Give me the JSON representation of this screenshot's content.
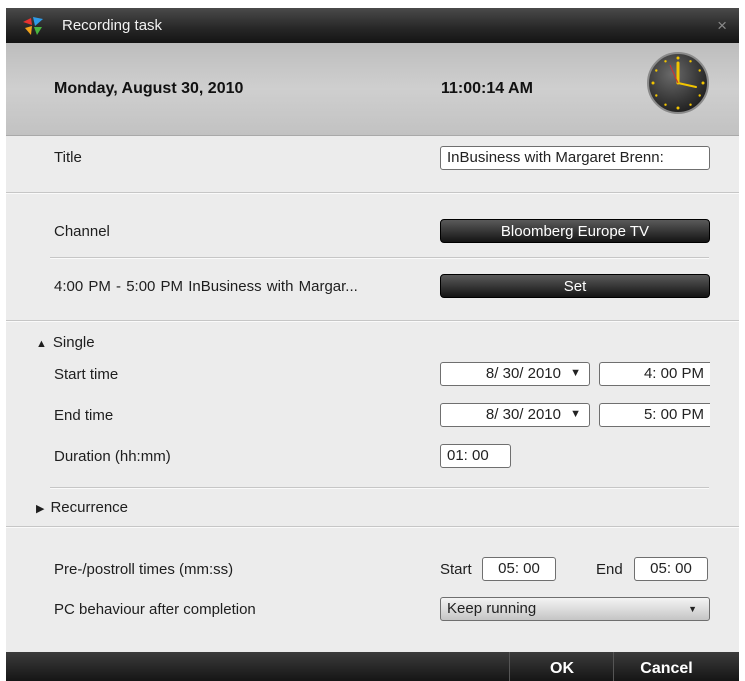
{
  "window": {
    "title": "Recording task",
    "close_label": "×"
  },
  "header": {
    "date": "Monday, August 30, 2010",
    "time": "11:00:14 AM"
  },
  "title_row": {
    "label": "Title",
    "value": "InBusiness with Margaret Brenn:"
  },
  "channel_row": {
    "label": "Channel",
    "button": "Bloomberg Europe TV"
  },
  "program_row": {
    "label": "4:00 PM - 5:00 PM   InBusiness with Margar...",
    "button": "Set"
  },
  "single": {
    "toggle": "Single",
    "start_label": "Start time",
    "start_date": "8/ 30/ 2010",
    "start_time": "4: 00  PM",
    "end_label": "End time",
    "end_date": "8/ 30/ 2010",
    "end_time": "5: 00  PM",
    "duration_label": "Duration (hh:mm)",
    "duration_value": "01: 00"
  },
  "recurrence": {
    "toggle": "Recurrence"
  },
  "preroll": {
    "label": "Pre-/postroll times (mm:ss)",
    "start_label": "Start",
    "start_value": "05: 00",
    "end_label": "End",
    "end_value": "05: 00"
  },
  "behaviour": {
    "label": "PC behaviour after completion",
    "value": "Keep running"
  },
  "footer": {
    "ok": "OK",
    "cancel": "Cancel"
  },
  "icons": {
    "app": "app-logo-icon",
    "clock": "clock-icon",
    "dropdown": "dropdown-arrow-icon",
    "close": "close-icon"
  }
}
